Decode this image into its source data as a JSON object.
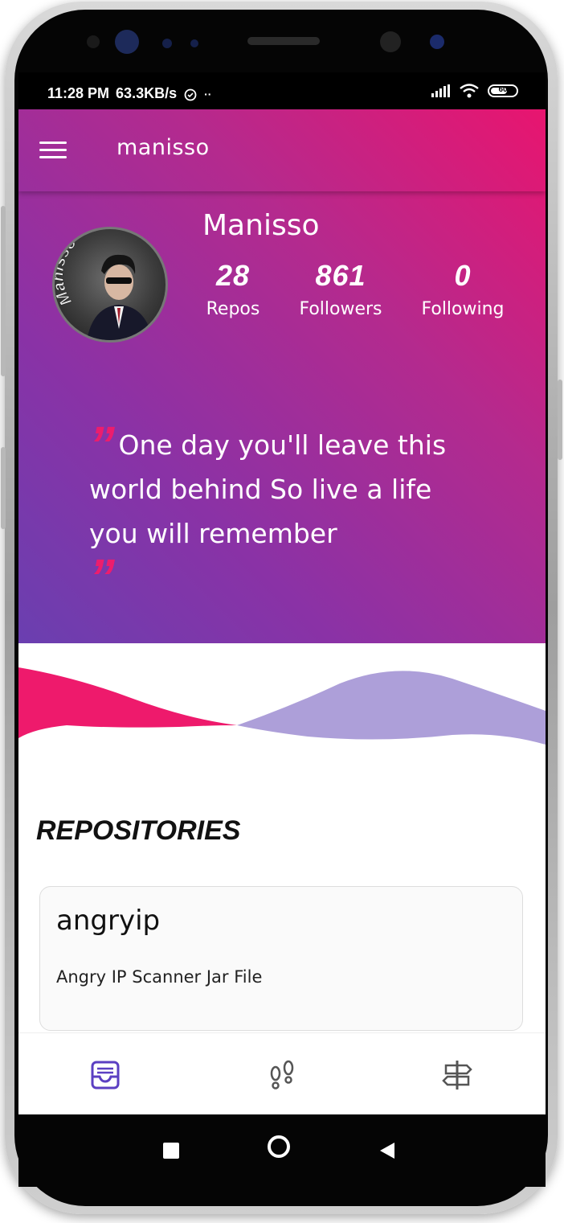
{
  "status_bar": {
    "time": "11:28 PM",
    "speed": "63.3KB/s",
    "battery": "60"
  },
  "app_bar": {
    "title": "manisso"
  },
  "profile": {
    "name": "Manisso",
    "avatar_text": "Manisso",
    "stats": [
      {
        "value": "28",
        "label": "Repos"
      },
      {
        "value": "861",
        "label": "Followers"
      },
      {
        "value": "0",
        "label": "Following"
      }
    ]
  },
  "quote": {
    "text": "One day you'll leave this world behind So live a life you will remember",
    "open_mark": "”",
    "close_mark": "”"
  },
  "repositories": {
    "title": "REPOSITORIES",
    "items": [
      {
        "name": "angryip",
        "description": "Angry IP Scanner Jar File"
      }
    ]
  },
  "bottom_nav": {
    "items": [
      {
        "icon": "inbox-icon",
        "active": true
      },
      {
        "icon": "footprints-icon",
        "active": false
      },
      {
        "icon": "signpost-icon",
        "active": false
      }
    ]
  },
  "colors": {
    "gradient_start": "#e8156f",
    "gradient_end": "#6a3fb0",
    "quote_mark": "#ec1d6d",
    "wave_pink": "#ee1a6c",
    "wave_lavender": "#ad9fd9",
    "nav_active": "#5b3fc2"
  }
}
